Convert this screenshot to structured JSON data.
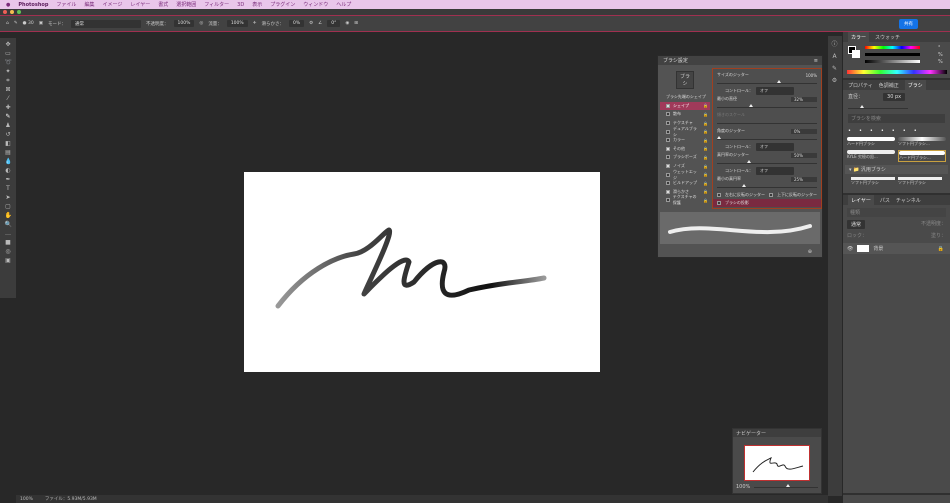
{
  "menubar": {
    "app": "Photoshop",
    "items": [
      "ファイル",
      "編集",
      "イメージ",
      "レイヤー",
      "書式",
      "選択範囲",
      "フィルター",
      "3D",
      "表示",
      "プラグイン",
      "ウィンドウ",
      "ヘルプ"
    ]
  },
  "options": {
    "mode_label": "モード：",
    "mode": "通常",
    "opacity_label": "不透明度：",
    "opacity": "100%",
    "flow_label": "流量：",
    "flow": "100%",
    "smoothing_label": "滑らかさ：",
    "smoothing": "0%",
    "angle": "0°",
    "brush_size": "30",
    "share": "共有"
  },
  "brush_settings": {
    "title": "ブラシ設定",
    "brushes_button": "ブラシ",
    "tip_shape": "ブラシ先端のシェイプ",
    "items": [
      {
        "label": "シェイプ",
        "checked": true,
        "active": true
      },
      {
        "label": "散布",
        "checked": false
      },
      {
        "label": "テクスチャ",
        "checked": false
      },
      {
        "label": "デュアルブラシ",
        "checked": false
      },
      {
        "label": "カラー",
        "checked": false
      },
      {
        "label": "その他",
        "checked": true
      },
      {
        "label": "ブラシポーズ",
        "checked": false
      },
      {
        "label": "ノイズ",
        "checked": true
      },
      {
        "label": "ウェットエッジ",
        "checked": false
      },
      {
        "label": "ビルドアップ",
        "checked": false
      },
      {
        "label": "滑らかさ",
        "checked": true
      },
      {
        "label": "テクスチャの保護",
        "checked": false
      }
    ],
    "size_jitter": {
      "label": "サイズのジッター",
      "value": "100%",
      "level": 1.0
    },
    "control_label": "コントロール：",
    "control_value": "オフ",
    "min_diameter": {
      "label": "最小の直径",
      "value": "32%",
      "level": 0.32
    },
    "tilt_scale": {
      "label": "傾きのスケール"
    },
    "angle_jitter": {
      "label": "角度のジッター",
      "value": "0%",
      "level": 0
    },
    "roundness_jitter": {
      "label": "真円率のジッター",
      "value": "50%",
      "level": 0.5
    },
    "min_roundness": {
      "label": "最小の真円率",
      "value": "25%",
      "level": 0.25
    },
    "flip_x": "左右に反転のジッター",
    "flip_y": "上下に反転のジッター",
    "projection": "ブラシの投影"
  },
  "color_panel": {
    "tabs": [
      "カラー",
      "スウォッチ"
    ],
    "units": [
      "°",
      "%",
      "%"
    ]
  },
  "brush_panel": {
    "tabs": [
      "プロパティ",
      "色調補正",
      "ブラシ"
    ],
    "size_label": "直径：",
    "size": "30 px",
    "search_placeholder": "ブラシを検索",
    "presets": [
      "ハード円ブラシ",
      "ソフト円ブラシ...",
      "KYLE 究極の鉛...",
      "ハード円ブラシ..."
    ],
    "group": "汎用ブラシ",
    "group_items": [
      "ソフト円ブラシ",
      "ソフト円ブラシ"
    ]
  },
  "layers_panel": {
    "tabs": [
      "レイヤー",
      "パス",
      "チャンネル"
    ],
    "kind": "種類",
    "mode": "通常",
    "opacity_label": "不透明度：",
    "lock_label": "ロック：",
    "fill_label": "塗り：",
    "layer_name": "背景"
  },
  "navigator": {
    "title": "ナビゲーター",
    "zoom": "100%"
  },
  "status": {
    "zoom": "100%",
    "file": "ファイル：5.93M/5.93M"
  }
}
